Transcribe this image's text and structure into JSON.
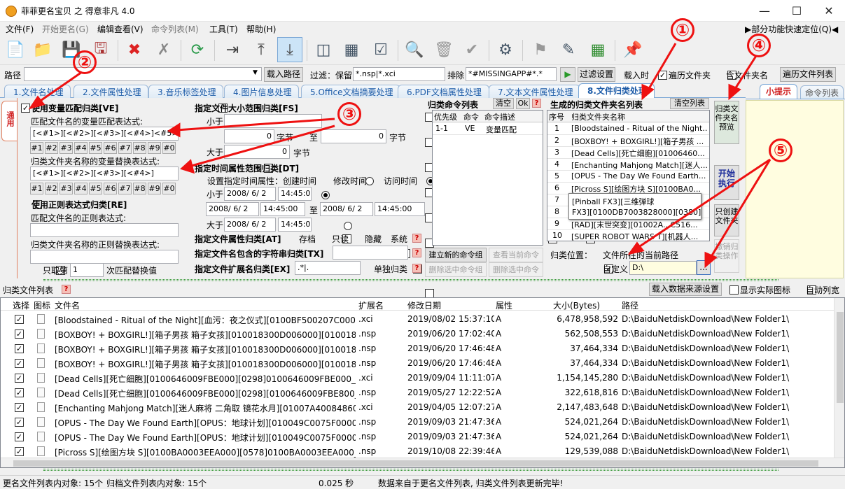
{
  "window": {
    "title": "菲菲更名宝贝 之 得意非凡 4.0"
  },
  "menu": [
    "文件(F)",
    "开始更名(G)",
    "编辑查看(V)",
    "命令列表(M)",
    "工具(T)",
    "帮助(H)"
  ],
  "menu_right": "▶部分功能快速定位(Q)◀",
  "path": {
    "label": "路径",
    "value": "",
    "load": "载入路径",
    "filter_label": "过滤：保留",
    "filter_value": "*.nsp|*.xci",
    "exclude_label": "排除",
    "exclude_value": "*#MISSINGAPP#*.*",
    "filter_btn": "过滤设置",
    "load_time": "载入时",
    "traverse": "遍历文件夹",
    "include_folder": "含文件夹名",
    "traverse_list": "遍历文件列表"
  },
  "tabs": [
    "1.文件名处理",
    "2.文件属性处理",
    "3.音乐标签处理",
    "4.图片信息处理",
    "5.Office文档摘要处理",
    "6.PDF文档属性处理",
    "7.文本文件属性处理",
    "8.文件归类处理"
  ],
  "side_tabs": {
    "hint": "小提示",
    "cmd": "命令列表"
  },
  "left_side_tab": "通用",
  "ve": {
    "use": "使用变量匹配归类[VE]",
    "match_label": "匹配文件名的变量匹配表达式:",
    "match_value": "[<#1>][<#2>][<#3>][<#4>]<#5>",
    "replace_label": "归类文件夹名称的变量替换表达式:",
    "replace_value": "[<#1>][<#2>][<#3>][<#4>]",
    "nums": [
      "#1",
      "#2",
      "#3",
      "#4",
      "#5",
      "#6",
      "#7",
      "#8",
      "#9",
      "#0"
    ]
  },
  "re": {
    "use": "使用正则表达式归类[RE]",
    "match_label": "匹配文件名的正则表达式:",
    "replace_label": "归类文件夹名称的正则替换表达式:",
    "only_label": "只取第",
    "only_value": "1",
    "only_suffix": "次匹配替换值"
  },
  "fs": {
    "title": "指定文件大小范围归类[FS]",
    "less": "小于",
    "greater": "大于",
    "to": "至",
    "unit": "字节",
    "v1": "0",
    "v2": "0",
    "v3": "0"
  },
  "dt": {
    "title": "指定时间属性范围归类[DT]",
    "set": "设置指定时间属性：",
    "create": "创建时间",
    "modify": "修改时间",
    "access": "访问时间",
    "less": "小于",
    "greater": "大于",
    "to": "至",
    "date": "2008/ 6/ 2",
    "time": "14:45:00"
  },
  "at": {
    "title": "指定文件属性归类[AT]",
    "archive": "存档",
    "readonly": "只读",
    "hidden": "隐藏",
    "system": "系统"
  },
  "tx": {
    "title": "指定文件名包含的字符串归类[TX]"
  },
  "ex": {
    "title": "指定文件扩展名归类[EX]",
    "value": ".*|.",
    "single": "单独归类"
  },
  "cmdlist": {
    "title": "归类命令列表",
    "clear": "清空",
    "ok": "Ok",
    "headers": [
      "优先级",
      "命令",
      "命令描述"
    ],
    "rows": [
      {
        "p": "1-1",
        "c": "VE",
        "d": "变量匹配"
      }
    ],
    "new": "建立新的命令组",
    "view": "查看当前命令",
    "del_group": "删除选中命令组",
    "del_cmd": "删除选中命令"
  },
  "folders": {
    "title": "生成的归类文件夹名列表",
    "clear": "清空列表",
    "headers": [
      "序号",
      "归类文件夹名称"
    ],
    "rows": [
      {
        "n": "1",
        "name": "[Bloodstained - Ritual of the Night..."
      },
      {
        "n": "2",
        "name": "[BOXBOY! + BOXGIRL!][箱子男孩 ..."
      },
      {
        "n": "3",
        "name": "[Dead Cells][死亡细胞][01006460..."
      },
      {
        "n": "4",
        "name": "[Enchanting Mahjong Match][迷人..."
      },
      {
        "n": "5",
        "name": "[OPUS - The Day We Found Earth..."
      },
      {
        "n": "6",
        "name": "[Picross S][绘图方块 S][0100BA0..."
      },
      {
        "n": "7",
        "name": "[Pinball FX3][三维弹球"
      },
      {
        "n": "8",
        "name": "FX3][0100DB7003828000][0380]"
      },
      {
        "n": "9",
        "name": "[RAD][末世突变][01002A...C516..."
      },
      {
        "n": "10",
        "name": "[SUPER ROBOT WARS T][机器人..."
      }
    ],
    "location_label": "归类位置：",
    "loc_opt1": "文件所在的当前路径",
    "loc_opt2": "自定义",
    "custom_path": "D:\\",
    "browse": "..."
  },
  "sidebtns": {
    "preview": "归类文件夹名预览",
    "start": "开始执行",
    "only_create": "只创建文件夹",
    "undo": "撤销归类操作"
  },
  "annotations": [
    "①",
    "②",
    "③",
    "④",
    "⑤"
  ],
  "filelist": {
    "title": "归类文件列表",
    "load_src": "载入数据来源设置",
    "show_icon": "显示实际图标",
    "auto_col": "自动列宽",
    "headers": [
      "选择",
      "图标",
      "文件名",
      "扩展名",
      "修改日期",
      "属性",
      "大小(Bytes)",
      "路径"
    ],
    "rows": [
      {
        "name": "[Bloodstained -  Ritual of the Night][血污：夜之仪式][0100BF500207C000]...",
        "ext": ".xci",
        "date": "2019/08/02 15:37:10",
        "attr": "A",
        "size": "6,478,958,592",
        "path": "D:\\BaiduNetdiskDownload\\New Folder1\\"
      },
      {
        "name": "[BOXBOY! + BOXGIRL!][箱子男孩 箱子女孩][010018300D006000][010018...",
        "ext": ".nsp",
        "date": "2019/06/20 17:02:40",
        "attr": "A",
        "size": "562,508,553",
        "path": "D:\\BaiduNetdiskDownload\\New Folder1\\"
      },
      {
        "name": "[BOXBOY! + BOXGIRL!][箱子男孩 箱子女孩][010018300D006000][010018...",
        "ext": ".nsp",
        "date": "2019/06/20 17:46:48",
        "attr": "A",
        "size": "37,464,334",
        "path": "D:\\BaiduNetdiskDownload\\New Folder1\\"
      },
      {
        "name": "[BOXBOY! + BOXGIRL!][箱子男孩 箱子女孩][010018300D006000][010018...",
        "ext": ".nsp",
        "date": "2019/06/20 17:46:48",
        "attr": "A",
        "size": "37,464,334",
        "path": "D:\\BaiduNetdiskDownload\\New Folder1\\"
      },
      {
        "name": "[Dead Cells][死亡细胞][0100646009FBE000][0298]0100646009FBE000_0_X...",
        "ext": ".xci",
        "date": "2019/09/04 11:11:07",
        "attr": "A",
        "size": "1,154,145,280",
        "path": "D:\\BaiduNetdiskDownload\\New Folder1\\"
      },
      {
        "name": "[Dead Cells][死亡细胞][0100646009FBE000][0298][0100646009FBE800_327...",
        "ext": ".nsp",
        "date": "2019/05/27 12:22:52",
        "attr": "A",
        "size": "322,618,816",
        "path": "D:\\BaiduNetdiskDownload\\New Folder1\\"
      },
      {
        "name": "[Enchanting Mahjong Match][迷人麻将 二角取 镜花水月][01007A40084860...",
        "ext": ".xci",
        "date": "2019/04/05 12:07:27",
        "attr": "A",
        "size": "2,147,483,648",
        "path": "D:\\BaiduNetdiskDownload\\New Folder1\\"
      },
      {
        "name": "[OPUS -  The Day We Found Earth][OPUS：地球计划][010049C0075F0000...",
        "ext": ".nsp",
        "date": "2019/09/03 21:47:36",
        "attr": "A",
        "size": "524,021,264",
        "path": "D:\\BaiduNetdiskDownload\\New Folder1\\"
      },
      {
        "name": "[OPUS -  The Day We Found Earth][OPUS：地球计划][010049C0075F0000...",
        "ext": ".nsp",
        "date": "2019/09/03 21:47:36",
        "attr": "A",
        "size": "524,021,264",
        "path": "D:\\BaiduNetdiskDownload\\New Folder1\\"
      },
      {
        "name": "[Picross S][绘图方块 S][0100BA0003EEA000][0578]0100BA0003EEA000_13...",
        "ext": ".nsp",
        "date": "2019/10/08 22:39:46",
        "attr": "A",
        "size": "129,539,088",
        "path": "D:\\BaiduNetdiskDownload\\New Folder1\\"
      }
    ]
  },
  "status": {
    "count": "更名文件列表内对象: 15个",
    "archived": "归档文件列表内对象: 15个",
    "time": "0.025 秒",
    "msg": "数据来自于更名文件列表, 归类文件列表更新完毕!"
  },
  "colors": {
    "accent": "#1e5ca8",
    "annotation": "#e11111",
    "hint_bg": "#fffde0"
  }
}
